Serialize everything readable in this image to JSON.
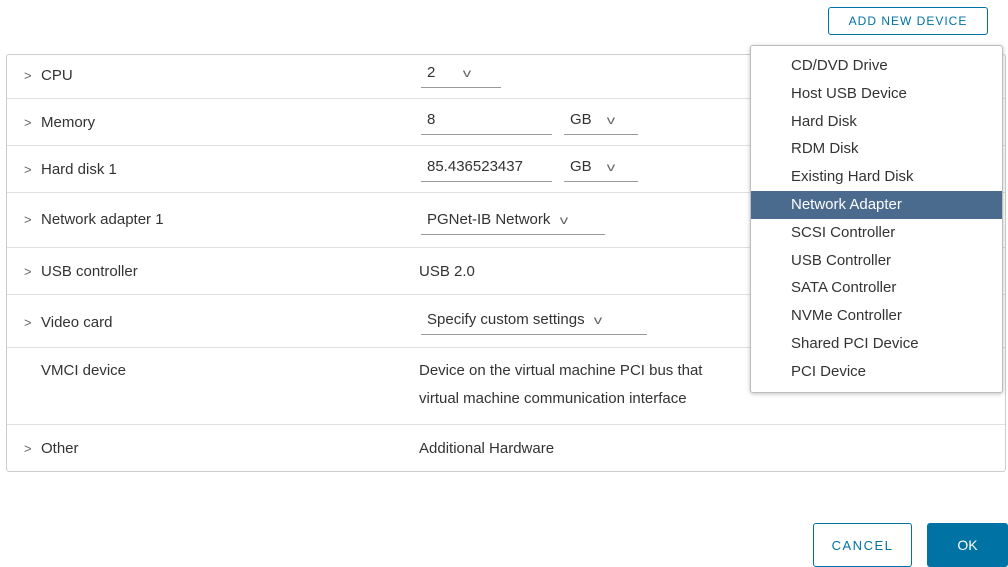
{
  "toolbar": {
    "add_device_label": "ADD NEW DEVICE"
  },
  "rows": {
    "cpu": {
      "label": "CPU",
      "value": "2"
    },
    "memory": {
      "label": "Memory",
      "value": "8",
      "unit": "GB"
    },
    "hard_disk": {
      "label": "Hard disk 1",
      "value": "85.436523437",
      "unit": "GB"
    },
    "network": {
      "label": "Network adapter 1",
      "value": "PGNet-IB Network"
    },
    "usb": {
      "label": "USB controller",
      "value": "USB 2.0"
    },
    "video": {
      "label": "Video card",
      "value": "Specify custom settings"
    },
    "vmci": {
      "label": "VMCI device",
      "line1": "Device on the virtual machine PCI bus that",
      "line2": "virtual machine communication interface"
    },
    "other": {
      "label": "Other",
      "value": "Additional Hardware"
    }
  },
  "menu": {
    "items": [
      "CD/DVD Drive",
      "Host USB Device",
      "Hard Disk",
      "RDM Disk",
      "Existing Hard Disk",
      "Network Adapter",
      "SCSI Controller",
      "USB Controller",
      "SATA Controller",
      "NVMe Controller",
      "Shared PCI Device",
      "PCI Device"
    ],
    "selected": "Network Adapter"
  },
  "footer": {
    "cancel_label": "CANCEL",
    "ok_label": "OK"
  },
  "icons": {
    "expand": "chevron-right-icon",
    "dropdown": "chevron-down-icon"
  },
  "colors": {
    "accent": "#0072a3",
    "menu_selected": "#4a6a8e"
  }
}
